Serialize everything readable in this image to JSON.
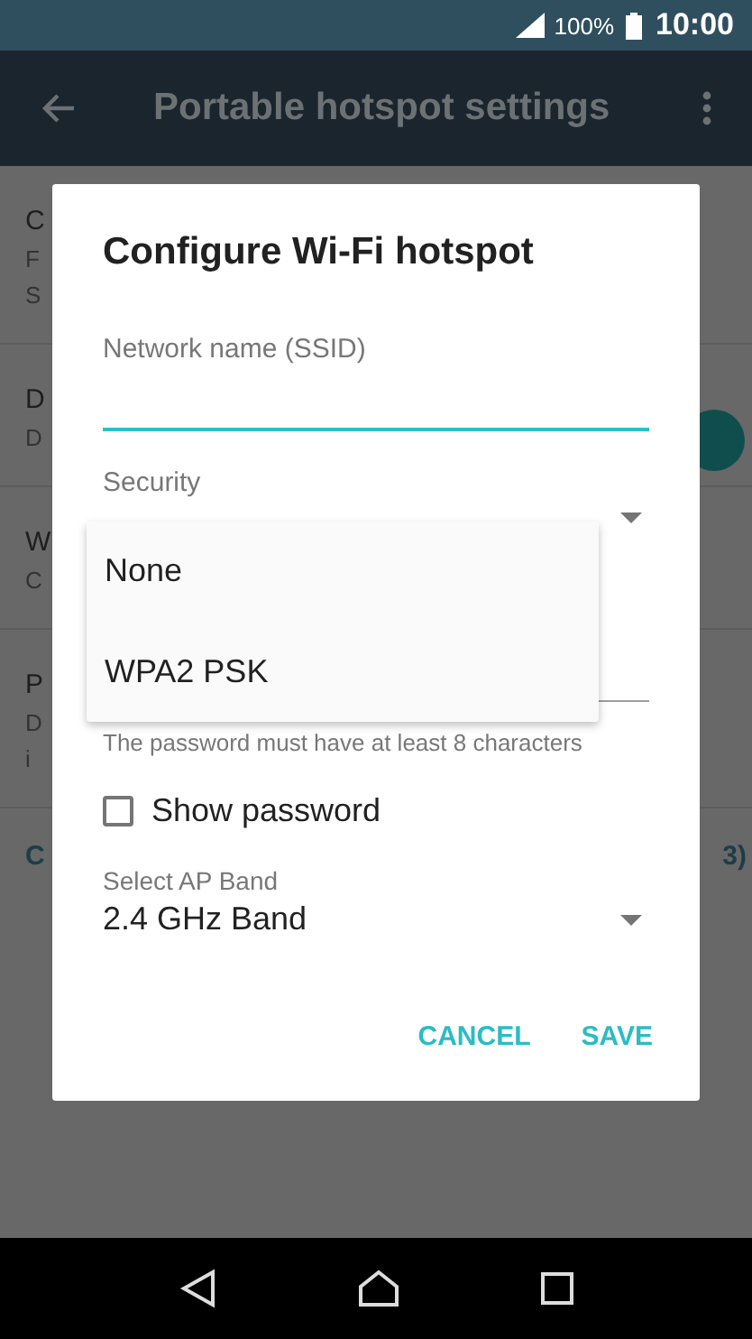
{
  "status_bar": {
    "battery": "100%",
    "time": "10:00"
  },
  "app_bar": {
    "title": "Portable hotspot settings"
  },
  "settings": [
    {
      "kind": "plain",
      "title": "C",
      "lines": [
        "F",
        "S"
      ]
    },
    {
      "kind": "switch",
      "title": "D",
      "lines": [
        "D"
      ],
      "on": true
    },
    {
      "kind": "plain",
      "title": "W",
      "lines": [
        "C"
      ]
    },
    {
      "kind": "plain",
      "title": "P",
      "lines": [
        "D",
        "i"
      ]
    }
  ],
  "link_row": {
    "left": "C",
    "right": "3)"
  },
  "dialog": {
    "title": "Configure Wi-Fi hotspot",
    "ssid": {
      "label": "Network name (SSID)",
      "focused": true
    },
    "security": {
      "label": "Security"
    },
    "password": {
      "hint": "The password must have at least 8 characters"
    },
    "show_password": {
      "label": "Show password",
      "checked": false
    },
    "ap_band": {
      "label": "Select AP Band",
      "value": "2.4 GHz Band"
    },
    "buttons": [
      "CANCEL",
      "SAVE"
    ]
  },
  "dropdown": {
    "options": [
      "None",
      "WPA2 PSK"
    ]
  }
}
